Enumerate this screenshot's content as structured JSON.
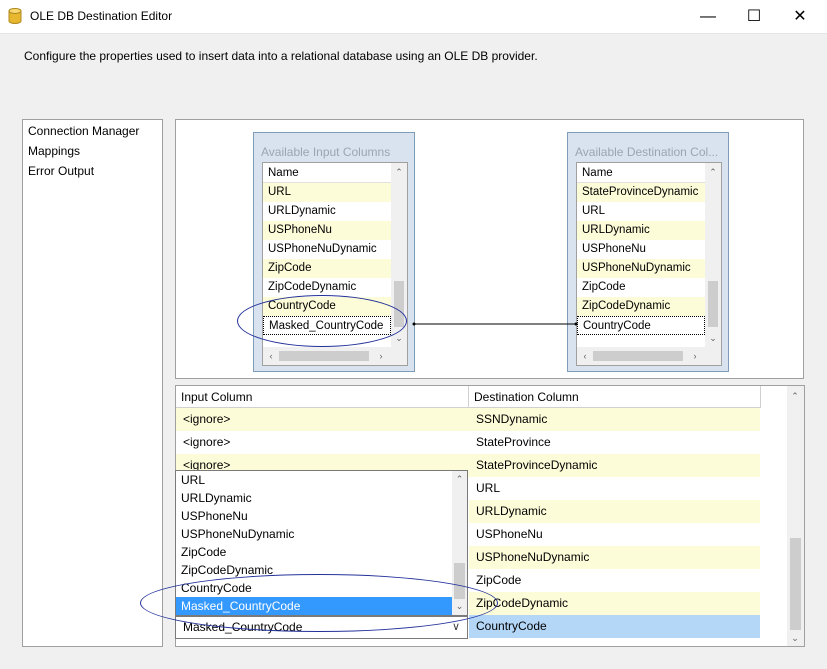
{
  "window": {
    "title": "OLE DB Destination Editor",
    "minimize_glyph": "—",
    "maximize_glyph": "☐",
    "close_glyph": "✕"
  },
  "description": "Configure the properties used to insert data into a relational database using an OLE DB provider.",
  "nav": {
    "items": [
      "Connection Manager",
      "Mappings",
      "Error Output"
    ]
  },
  "available_input": {
    "title": "Available Input Columns",
    "header": "Name",
    "rows": [
      "URL",
      "URLDynamic",
      "USPhoneNu",
      "USPhoneNuDynamic",
      "ZipCode",
      "ZipCodeDynamic",
      "CountryCode",
      "Masked_CountryCode"
    ]
  },
  "available_destination": {
    "title": "Available Destination Col...",
    "header": "Name",
    "rows": [
      "StateProvinceDynamic",
      "URL",
      "URLDynamic",
      "USPhoneNu",
      "USPhoneNuDynamic",
      "ZipCode",
      "ZipCodeDynamic",
      "CountryCode"
    ]
  },
  "grid": {
    "headers": [
      "Input Column",
      "Destination Column"
    ],
    "input_cells": [
      "<ignore>",
      "<ignore>",
      "<ignore>"
    ],
    "destination_cells": [
      "SSNDynamic",
      "StateProvince",
      "StateProvinceDynamic",
      "URL",
      "URLDynamic",
      "USPhoneNu",
      "USPhoneNuDynamic",
      "ZipCode",
      "ZipCodeDynamic",
      "CountryCode"
    ]
  },
  "dropdown": {
    "options": [
      "URL",
      "URLDynamic",
      "USPhoneNu",
      "USPhoneNuDynamic",
      "ZipCode",
      "ZipCodeDynamic",
      "CountryCode",
      "Masked_CountryCode"
    ],
    "selected": "Masked_CountryCode"
  },
  "combo": {
    "value": "Masked_CountryCode",
    "arrow": "∨"
  },
  "colors": {
    "highlight_row": "#fdfcd9",
    "selected_item": "#3399ff",
    "selected_cell": "#b5d7f7",
    "annotation_ellipse": "#23329b"
  },
  "icons": {
    "title": "database-cylinder-icon",
    "scroll_up": "chevron-up-icon",
    "scroll_down": "chevron-down-icon",
    "scroll_left": "chevron-left-icon",
    "scroll_right": "chevron-right-icon"
  }
}
